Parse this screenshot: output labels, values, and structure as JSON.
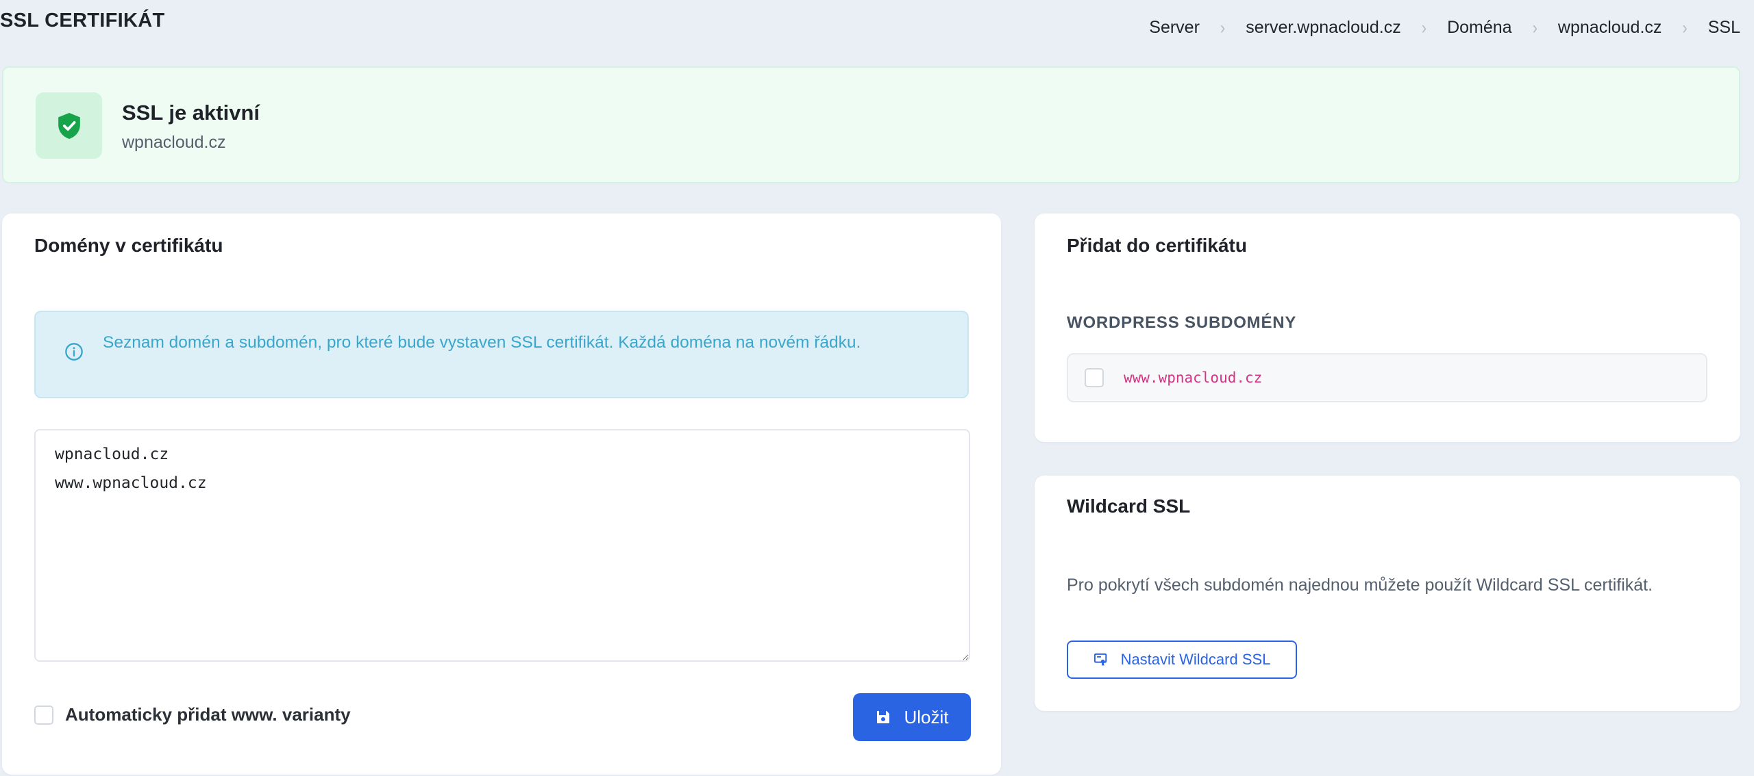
{
  "header": {
    "title": "SSL CERTIFIKÁT",
    "breadcrumb": [
      "Server",
      "server.wpnacloud.cz",
      "Doména",
      "wpnacloud.cz",
      "SSL"
    ]
  },
  "status": {
    "title": "SSL je aktivní",
    "domain": "wpnacloud.cz",
    "icon": "shield-check-icon",
    "color": "#16a34a"
  },
  "domains_card": {
    "title": "Domény v certifikátu",
    "info_text": "Seznam domén a subdomén, pro které bude vystaven SSL certifikát. Každá doména na novém řádku.",
    "textarea_value": "wpnacloud.cz\nwww.wpnacloud.cz",
    "auto_www_label": "Automaticky přidat www. varianty",
    "auto_www_checked": false,
    "save_label": "Uložit"
  },
  "add_card": {
    "title": "Přidat do certifikátu",
    "section_label": "WORDPRESS SUBDOMÉNY",
    "items": [
      {
        "label": "www.wpnacloud.cz",
        "checked": false
      }
    ]
  },
  "wildcard_card": {
    "title": "Wildcard SSL",
    "text": "Pro pokrytí všech subdomén najednou můžete použít Wildcard SSL certifikát.",
    "button_label": "Nastavit Wildcard SSL"
  },
  "colors": {
    "primary": "#2b64e3",
    "success_bg": "#effcf3",
    "info_bg": "#ddf0f8",
    "code": "#d63384"
  }
}
